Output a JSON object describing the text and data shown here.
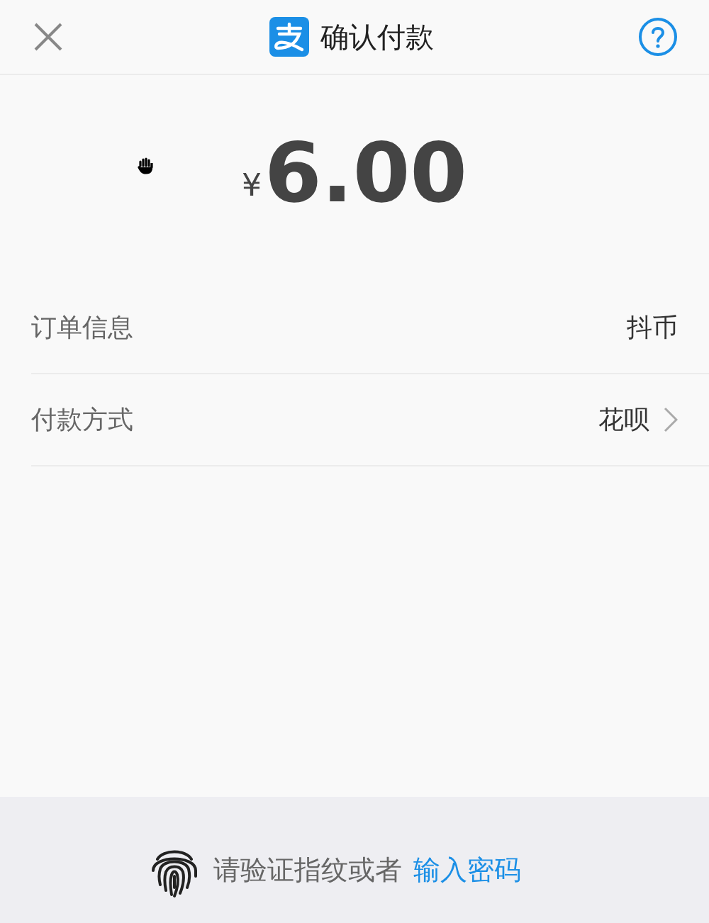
{
  "sheet": {
    "title": "确认付款",
    "currency": "¥",
    "amount": "6.00",
    "rows": [
      {
        "label": "订单信息",
        "value": "抖币",
        "kind": "plain"
      },
      {
        "label": "付款方式",
        "value": "花呗",
        "kind": "link"
      }
    ],
    "verify": {
      "text": "请验证指纹或者",
      "link": "输入密码"
    }
  }
}
